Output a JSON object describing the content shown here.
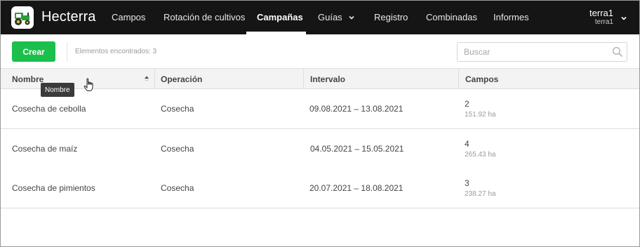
{
  "header": {
    "brand": "Hecterra",
    "nav": [
      {
        "label": "Campos"
      },
      {
        "label": "Rotación de cultivos"
      },
      {
        "label": "Campañas",
        "active": true
      },
      {
        "label": "Guías",
        "has_dropdown": true
      },
      {
        "label": "Registro"
      },
      {
        "label": "Combinadas"
      },
      {
        "label": "Informes"
      }
    ],
    "user": {
      "name": "terra1",
      "account": "terra1"
    },
    "logo_icon": "tractor-logo-icon",
    "colors": {
      "background": "#151515",
      "text": "#ffffff"
    }
  },
  "toolbar": {
    "create_label": "Crear",
    "found_text": "Elementos encontrados: 3",
    "search_placeholder": "Buscar",
    "colors": {
      "create_button": "#1bbf4c"
    }
  },
  "table": {
    "columns": [
      "Nombre",
      "Operación",
      "Intervalo",
      "Campos"
    ],
    "sorted_column": "Nombre",
    "sort_direction": "ascending",
    "rows": [
      {
        "nombre": "Cosecha de cebolla",
        "operacion": "Cosecha",
        "intervalo": "09.08.2021 – 13.08.2021",
        "campos_count": "2",
        "campos_area": "151.92 ha"
      },
      {
        "nombre": "Cosecha de maíz",
        "operacion": "Cosecha",
        "intervalo": "04.05.2021 – 15.05.2021",
        "campos_count": "4",
        "campos_area": "265.43 ha"
      },
      {
        "nombre": "Cosecha de pimientos",
        "operacion": "Cosecha",
        "intervalo": "20.07.2021 – 18.08.2021",
        "campos_count": "3",
        "campos_area": "238.27 ha"
      }
    ]
  },
  "tooltip": {
    "text": "Nombre"
  }
}
